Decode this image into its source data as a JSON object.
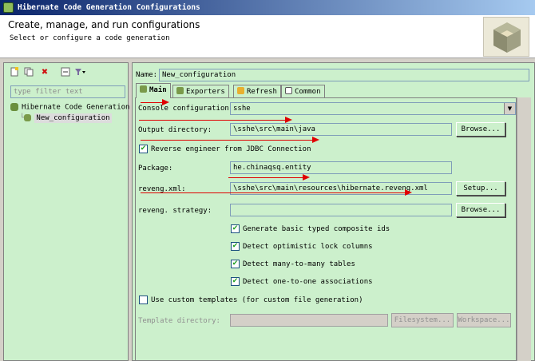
{
  "window": {
    "title": "Hibernate Code Generation Configurations"
  },
  "banner": {
    "heading": "Create, manage, and run configurations",
    "subheading": "Select or configure a code generation"
  },
  "left": {
    "toolbar": {
      "icons": [
        "new-config-icon",
        "duplicate-icon",
        "delete-icon",
        "collapse-icon",
        "filter-menu-icon"
      ]
    },
    "filter_placeholder": "type filter text",
    "tree": {
      "root": "Hibernate Code Generation",
      "child": "New_configuration"
    }
  },
  "name": {
    "label": "Name:",
    "value": "New_configuration"
  },
  "tabs": [
    {
      "label": "Main",
      "active": true
    },
    {
      "label": "Exporters"
    },
    {
      "label": "Refresh"
    },
    {
      "label": "Common"
    }
  ],
  "main": {
    "console_config": {
      "label": "Console configuration:",
      "value": "sshe"
    },
    "output_dir": {
      "label": "Output directory:",
      "value": "\\sshe\\src\\main\\java",
      "button": "Browse..."
    },
    "reverse_engineer": {
      "label": "Reverse engineer from JDBC Connection",
      "checked": true
    },
    "package": {
      "label": "Package:",
      "value": "he.chinaqsq.entity"
    },
    "reveng_xml": {
      "label": "reveng.xml:",
      "value": "\\sshe\\src\\main\\resources\\hibernate.reveng.xml",
      "button": "Setup..."
    },
    "reveng_strategy": {
      "label": "reveng. strategy:",
      "value": "",
      "button": "Browse..."
    },
    "options": [
      {
        "label": "Generate basic typed composite ids",
        "checked": true
      },
      {
        "label": "Detect optimistic lock columns",
        "checked": true
      },
      {
        "label": "Detect many-to-many tables",
        "checked": true
      },
      {
        "label": "Detect one-to-one associations",
        "checked": true
      }
    ],
    "custom_templates": {
      "label": "Use custom templates (for custom file generation)",
      "checked": false
    },
    "template_dir": {
      "label": "Template directory:",
      "value": "",
      "filesystem_button": "Filesystem...",
      "workspace_button": "Workspace..."
    }
  },
  "colors": {
    "panel": "#ccf0cc",
    "annotation": "#e00000"
  }
}
